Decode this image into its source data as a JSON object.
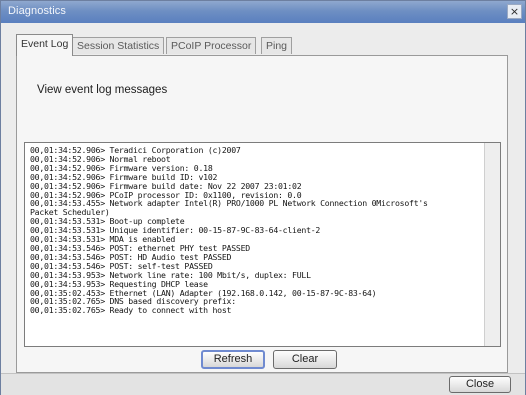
{
  "window": {
    "title": "Diagnostics",
    "close_glyph": "×"
  },
  "tabs": [
    {
      "label": "Event Log",
      "active": true
    },
    {
      "label": "Session Statistics",
      "active": false
    },
    {
      "label": "PCoIP Processor",
      "active": false
    },
    {
      "label": "Ping",
      "active": false
    }
  ],
  "event_log": {
    "heading": "View event log messages",
    "lines": [
      "00,01:34:52.906> Teradici Corporation (c)2007",
      "00,01:34:52.906> Normal reboot",
      "00,01:34:52.906> Firmware version: 0.18",
      "00,01:34:52.906> Firmware build ID: v102",
      "00,01:34:52.906> Firmware build date: Nov 22 2007 23:01:02",
      "00,01:34:52.906> PCoIP processor ID: 0x1100, revision: 0.0",
      "00,01:34:53.455> Network adapter Intel(R) PRO/1000 PL Network Connection 0Microsoft's",
      "Packet Scheduler)",
      "00,01:34:53.531> Boot-up complete",
      "00,01:34:53.531> Unique identifier: 00-15-87-9C-83-64-client-2",
      "00,01:34:53.531> MDA is enabled",
      "00,01:34:53.546> POST: ethernet PHY test PASSED",
      "00,01:34:53.546> POST: HD Audio test PASSED",
      "00,01:34:53.546> POST: self-test PASSED",
      "00,01:34:53.953> Network line rate: 100 Mbit/s, duplex: FULL",
      "00,01:34:53.953> Requesting DHCP lease",
      "00,01:35:02.453> Ethernet (LAN) Adapter (192.168.0.142, 00-15-87-9C-83-64)",
      "00,01:35:02.765> DNS based discovery prefix:",
      "00,01:35:02.765> Ready to connect with host"
    ],
    "refresh_label": "Refresh",
    "clear_label": "Clear"
  },
  "footer": {
    "close_label": "Close"
  }
}
